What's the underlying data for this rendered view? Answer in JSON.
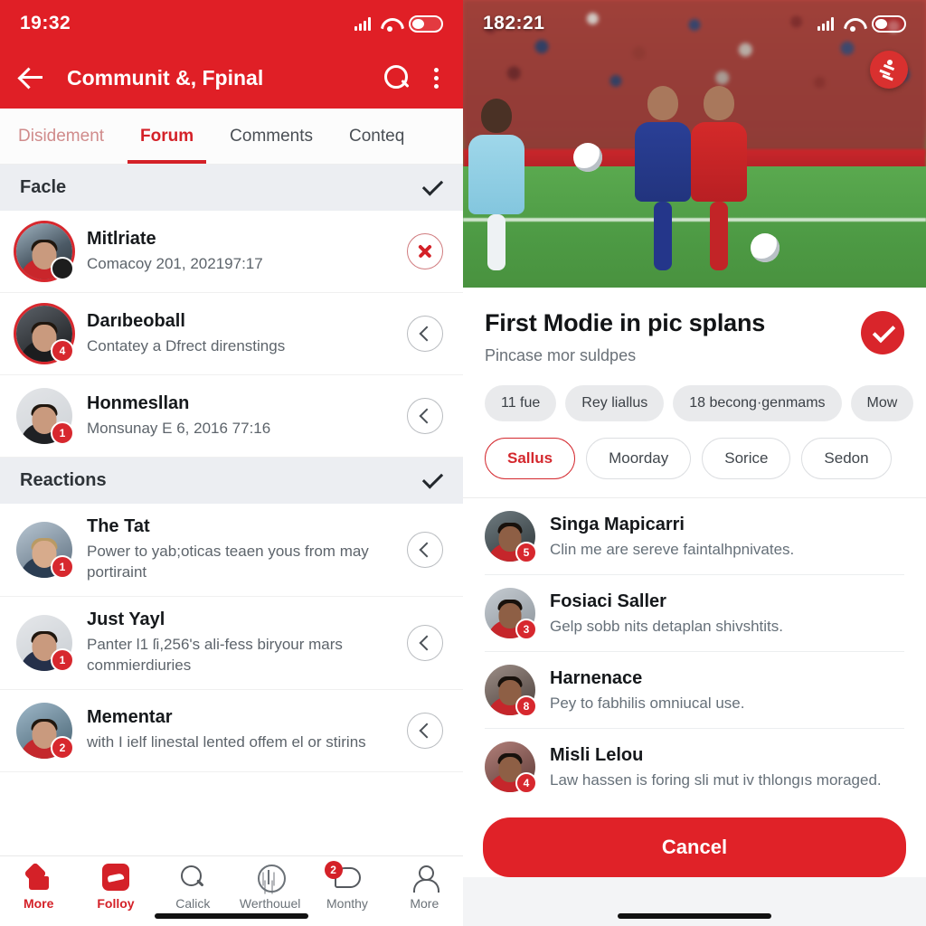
{
  "left": {
    "status": {
      "time": "19:32",
      "signal_icon": "signal-bars-icon",
      "wifi_icon": "wifi-icon",
      "battery_icon": "battery-icon"
    },
    "appbar": {
      "back_icon": "back-arrow-icon",
      "title": "Communit &, Fpinal",
      "search_icon": "search-icon",
      "overflow_icon": "kebab-menu-icon"
    },
    "tabs": [
      {
        "label": "Disidement",
        "state": "muted"
      },
      {
        "label": "Forum",
        "state": "active"
      },
      {
        "label": "Comments",
        "state": "normal"
      },
      {
        "label": "Conteq",
        "state": "normal"
      }
    ],
    "sections": [
      {
        "title": "Facle",
        "action_icon": "check-icon",
        "rows": [
          {
            "title": "Mitlriate",
            "subtitle": "Comacoy 201, 202197:17",
            "badge": "",
            "badge_style": "dark",
            "action": "remove",
            "action_icon": "close-circle-icon"
          },
          {
            "title": "Darıbeoball",
            "subtitle": "Contatey a Dfrect direnstings",
            "badge": "4",
            "badge_style": "red",
            "action": "open",
            "action_icon": "chevron-left-icon"
          },
          {
            "title": "Honmesllan",
            "subtitle": "Monsunay E 6, 2016 77:16",
            "badge": "1",
            "badge_style": "red",
            "action": "open",
            "action_icon": "chevron-left-icon"
          }
        ]
      },
      {
        "title": "Reactions",
        "action_icon": "check-icon",
        "rows": [
          {
            "title": "The Tat",
            "subtitle": "Power to yab;oticas teaen yous from may portiraint",
            "badge": "1",
            "badge_style": "red",
            "action": "open",
            "action_icon": "chevron-left-icon"
          },
          {
            "title": "Just Yayl",
            "subtitle": "Panter l1 ſi,256's ali-fess biryour mars commierdiuries",
            "badge": "1",
            "badge_style": "red",
            "action": "open",
            "action_icon": "chevron-left-icon"
          },
          {
            "title": "Mementar",
            "subtitle": "with I ielf linestal lented offem el or stirins",
            "badge": "2",
            "badge_style": "red",
            "action": "open",
            "action_icon": "chevron-left-icon"
          }
        ]
      }
    ],
    "bottom_nav": [
      {
        "label": "More",
        "icon": "home-icon",
        "active": true,
        "badge": ""
      },
      {
        "label": "Folloy",
        "icon": "feed-tile-icon",
        "active": true,
        "badge": ""
      },
      {
        "label": "Calick",
        "icon": "search-icon",
        "active": false,
        "badge": ""
      },
      {
        "label": "Werthoɯel",
        "icon": "compass-circle-icon",
        "active": false,
        "badge": ""
      },
      {
        "label": "Monthy",
        "icon": "chat-bubble-icon",
        "active": false,
        "badge": "2"
      },
      {
        "label": "More",
        "icon": "person-icon",
        "active": false,
        "badge": ""
      }
    ]
  },
  "right": {
    "status": {
      "time": "182:21",
      "signal_icon": "signal-bars-icon",
      "wifi_icon": "wifi-icon",
      "battery_icon": "battery-icon"
    },
    "hero": {
      "image_alt": "soccer-match-photo",
      "fab_icon": "runner-icon"
    },
    "sheet": {
      "title": "First Modie in pic splans",
      "subtitle": "Pincase mor suldpes",
      "confirm_icon": "check-circle-icon"
    },
    "chips": [
      "11 fue",
      "Rey liallus",
      "18 becong·genmams",
      "Mow"
    ],
    "pills": [
      {
        "label": "Sallus",
        "selected": true
      },
      {
        "label": "Moorday",
        "selected": false
      },
      {
        "label": "Sorice",
        "selected": false
      },
      {
        "label": "Sedon",
        "selected": false
      }
    ],
    "rows": [
      {
        "title": "Singa Mapicarri",
        "subtitle": "Clin me are sereve faintalhpnivates.",
        "badge": "5"
      },
      {
        "title": "Fosiaci Saller",
        "subtitle": "Gelp sobb nits detaplan shivshtits.",
        "badge": "3"
      },
      {
        "title": "Harnenace",
        "subtitle": "Pey to fabhilis omniucal use.",
        "badge": "8"
      },
      {
        "title": "Misli Lelou",
        "subtitle": "Law hassen is foring sli mut iv thlongıs moraged.",
        "badge": "4"
      }
    ],
    "cancel_label": "Cancel"
  },
  "colors": {
    "brand_red": "#e01f26",
    "accent_red": "#d42128",
    "section_bg": "#eceef2"
  }
}
